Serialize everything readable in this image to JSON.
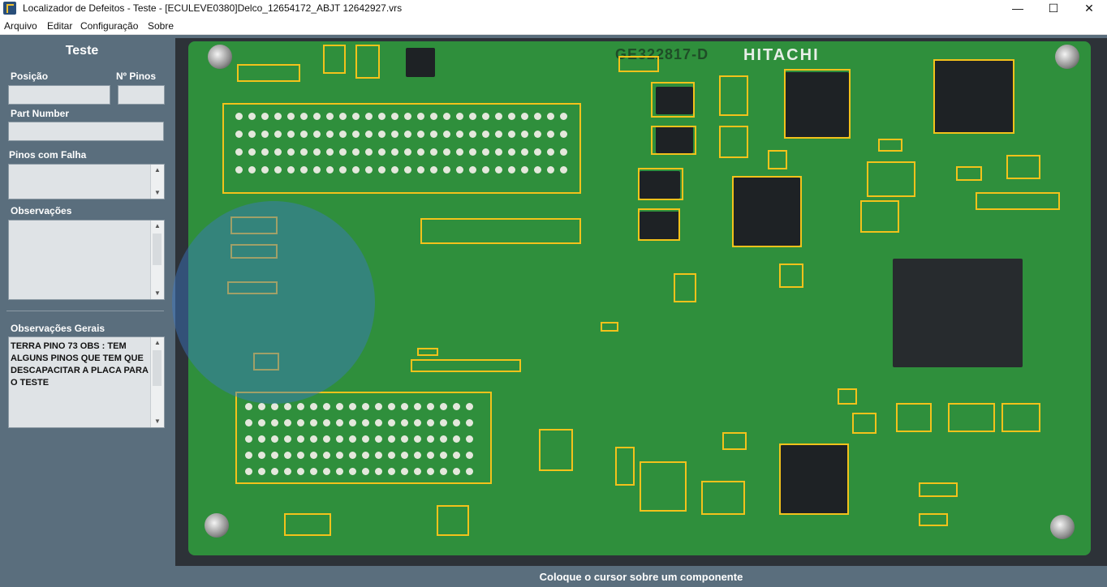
{
  "window": {
    "title": "Localizador de Defeitos - Teste - [ECULEVE0380]Delco_12654172_ABJT 12642927.vrs",
    "minimize": "—",
    "maximize": "☐",
    "close": "✕"
  },
  "menu": [
    "Arquivo",
    "Editar",
    "Configuração",
    "Sobre"
  ],
  "panel": {
    "title": "Teste",
    "posicao_label": "Posição",
    "posicao_value": "",
    "npinos_label": "Nº Pinos",
    "npinos_value": "",
    "partnumber_label": "Part Number",
    "partnumber_value": "",
    "pinos_falha_label": "Pinos com Falha",
    "pinos_falha_value": "",
    "observacoes_label": "Observações",
    "observacoes_value": "",
    "obs_gerais_label": "Observações Gerais",
    "obs_gerais_value": "TERRA PINO 73 OBS : TEM ALGUNS PINOS QUE TEM QUE DESCAPACITAR A PLACA PARA O TESTE"
  },
  "board": {
    "marking": "GE322817-D",
    "brand": "HITACHI",
    "highlight_color": "#f3c21b"
  },
  "status": "Coloque o cursor sobre um componente"
}
